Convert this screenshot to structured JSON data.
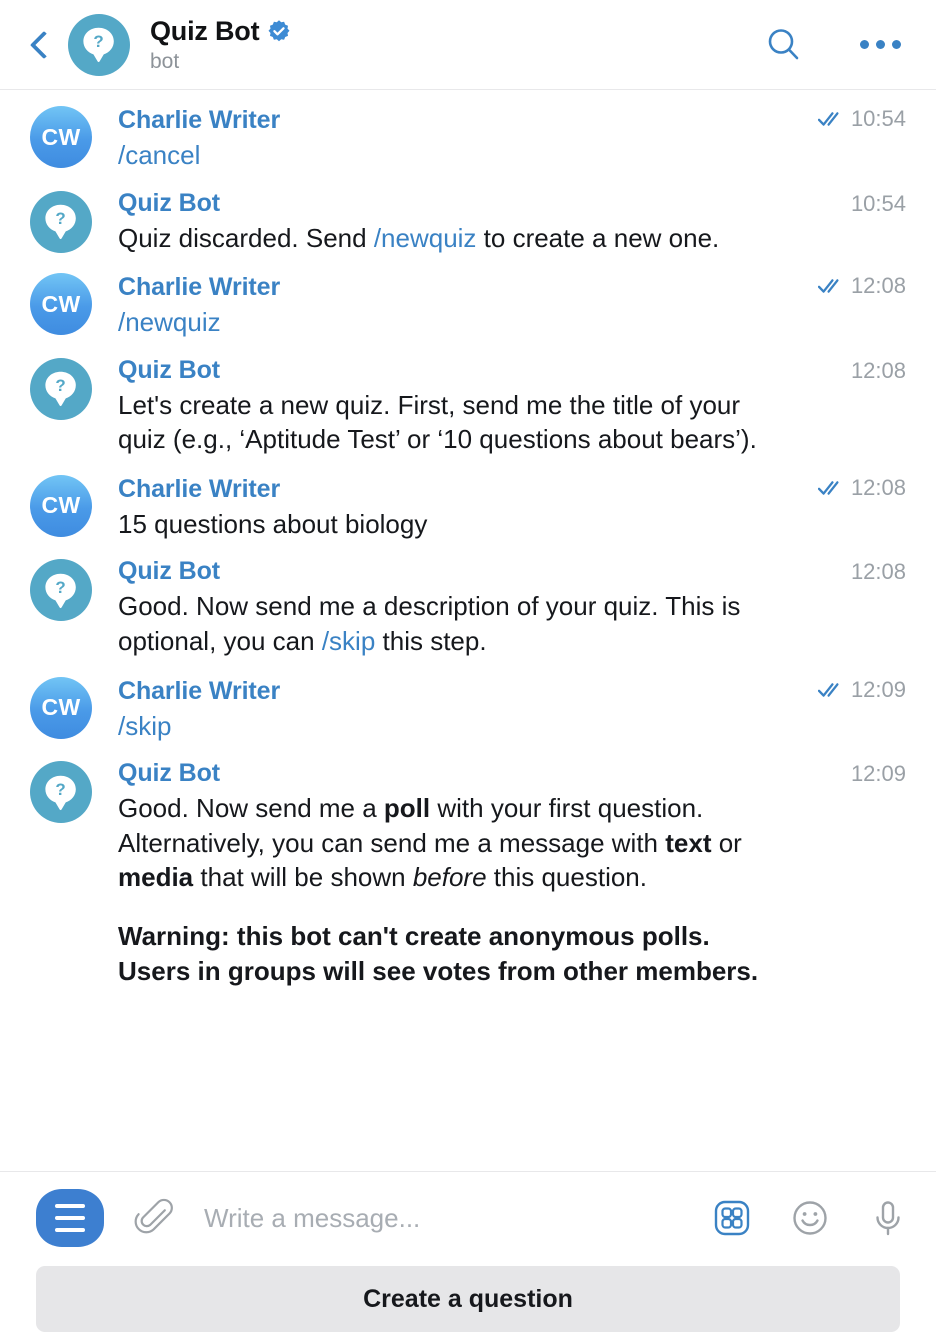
{
  "header": {
    "back_icon": "chevron-left-icon",
    "avatar_icon": "quiz-bot-avatar",
    "title": "Quiz Bot",
    "verified_icon": "verified-badge-icon",
    "subtitle": "bot",
    "search_icon": "search-icon",
    "more_icon": "more-options-icon",
    "accent_color": "#3a82c4",
    "bot_avatar_color": "#54a8c7"
  },
  "messages": [
    {
      "avatar_type": "user",
      "avatar_initials": "CW",
      "sender": "Charlie Writer",
      "time": "10:54",
      "read": true,
      "text": "/cancel",
      "style": "command"
    },
    {
      "avatar_type": "bot",
      "avatar_initials": "",
      "sender": "Quiz Bot",
      "time": "10:54",
      "read": false,
      "text": "Quiz discarded. Send /newquiz to create a new one.",
      "style": "rich-1"
    },
    {
      "avatar_type": "user",
      "avatar_initials": "CW",
      "sender": "Charlie Writer",
      "time": "12:08",
      "read": true,
      "text": "/newquiz",
      "style": "command"
    },
    {
      "avatar_type": "bot",
      "avatar_initials": "",
      "sender": "Quiz Bot",
      "time": "12:08",
      "read": false,
      "text": "Let's create a new quiz. First, send me the title of your quiz (e.g., ‘Aptitude Test’ or ‘10 questions about bears’).",
      "style": "plain"
    },
    {
      "avatar_type": "user",
      "avatar_initials": "CW",
      "sender": "Charlie Writer",
      "time": "12:08",
      "read": true,
      "text": "15 questions about biology",
      "style": "plain"
    },
    {
      "avatar_type": "bot",
      "avatar_initials": "",
      "sender": "Quiz Bot",
      "time": "12:08",
      "read": false,
      "text": "Good. Now send me a description of your quiz. This is optional, you can /skip this step.",
      "style": "rich-2"
    },
    {
      "avatar_type": "user",
      "avatar_initials": "CW",
      "sender": "Charlie Writer",
      "time": "12:09",
      "read": true,
      "text": "/skip",
      "style": "command"
    },
    {
      "avatar_type": "bot",
      "avatar_initials": "",
      "sender": "Quiz Bot",
      "time": "12:09",
      "read": false,
      "text": "Good. Now send me a poll with your first question. Alternatively, you can send me a message with text or media that will be shown before this question.\n\nWarning: this bot can't create anonymous polls.\nUsers in groups will see votes from other members.",
      "style": "rich-3"
    }
  ],
  "rich_text": {
    "msg2": {
      "a": "Quiz discarded. Send ",
      "link": "/newquiz",
      "b": " to create a new one."
    },
    "msg6": {
      "a": "Good. Now send me a description of your quiz. This is optional, you can ",
      "link": "/skip",
      "b": " this step."
    },
    "msg8": {
      "a": "Good. Now send me a ",
      "bold1": "poll",
      "b": " with your first question. Alternatively, you can send me a message with ",
      "bold2": "text",
      "c": " or ",
      "bold3": "media",
      "d": " that will be shown ",
      "italic1": "before",
      "e": " this question.",
      "warn1": "Warning: this bot can't create anonymous polls.",
      "warn2": "Users in groups will see votes from other members."
    }
  },
  "composer": {
    "menu_icon": "bot-commands-menu-icon",
    "attach_icon": "paperclip-icon",
    "input_value": "",
    "input_placeholder": "Write a message...",
    "keyboard_icon": "bot-keyboard-grid-icon",
    "emoji_icon": "smiley-icon",
    "mic_icon": "microphone-icon",
    "menu_button_color": "#3d7fd0",
    "keyboard_icon_color": "#3a82c4"
  },
  "keyboard": {
    "create_question_label": "Create a question"
  }
}
